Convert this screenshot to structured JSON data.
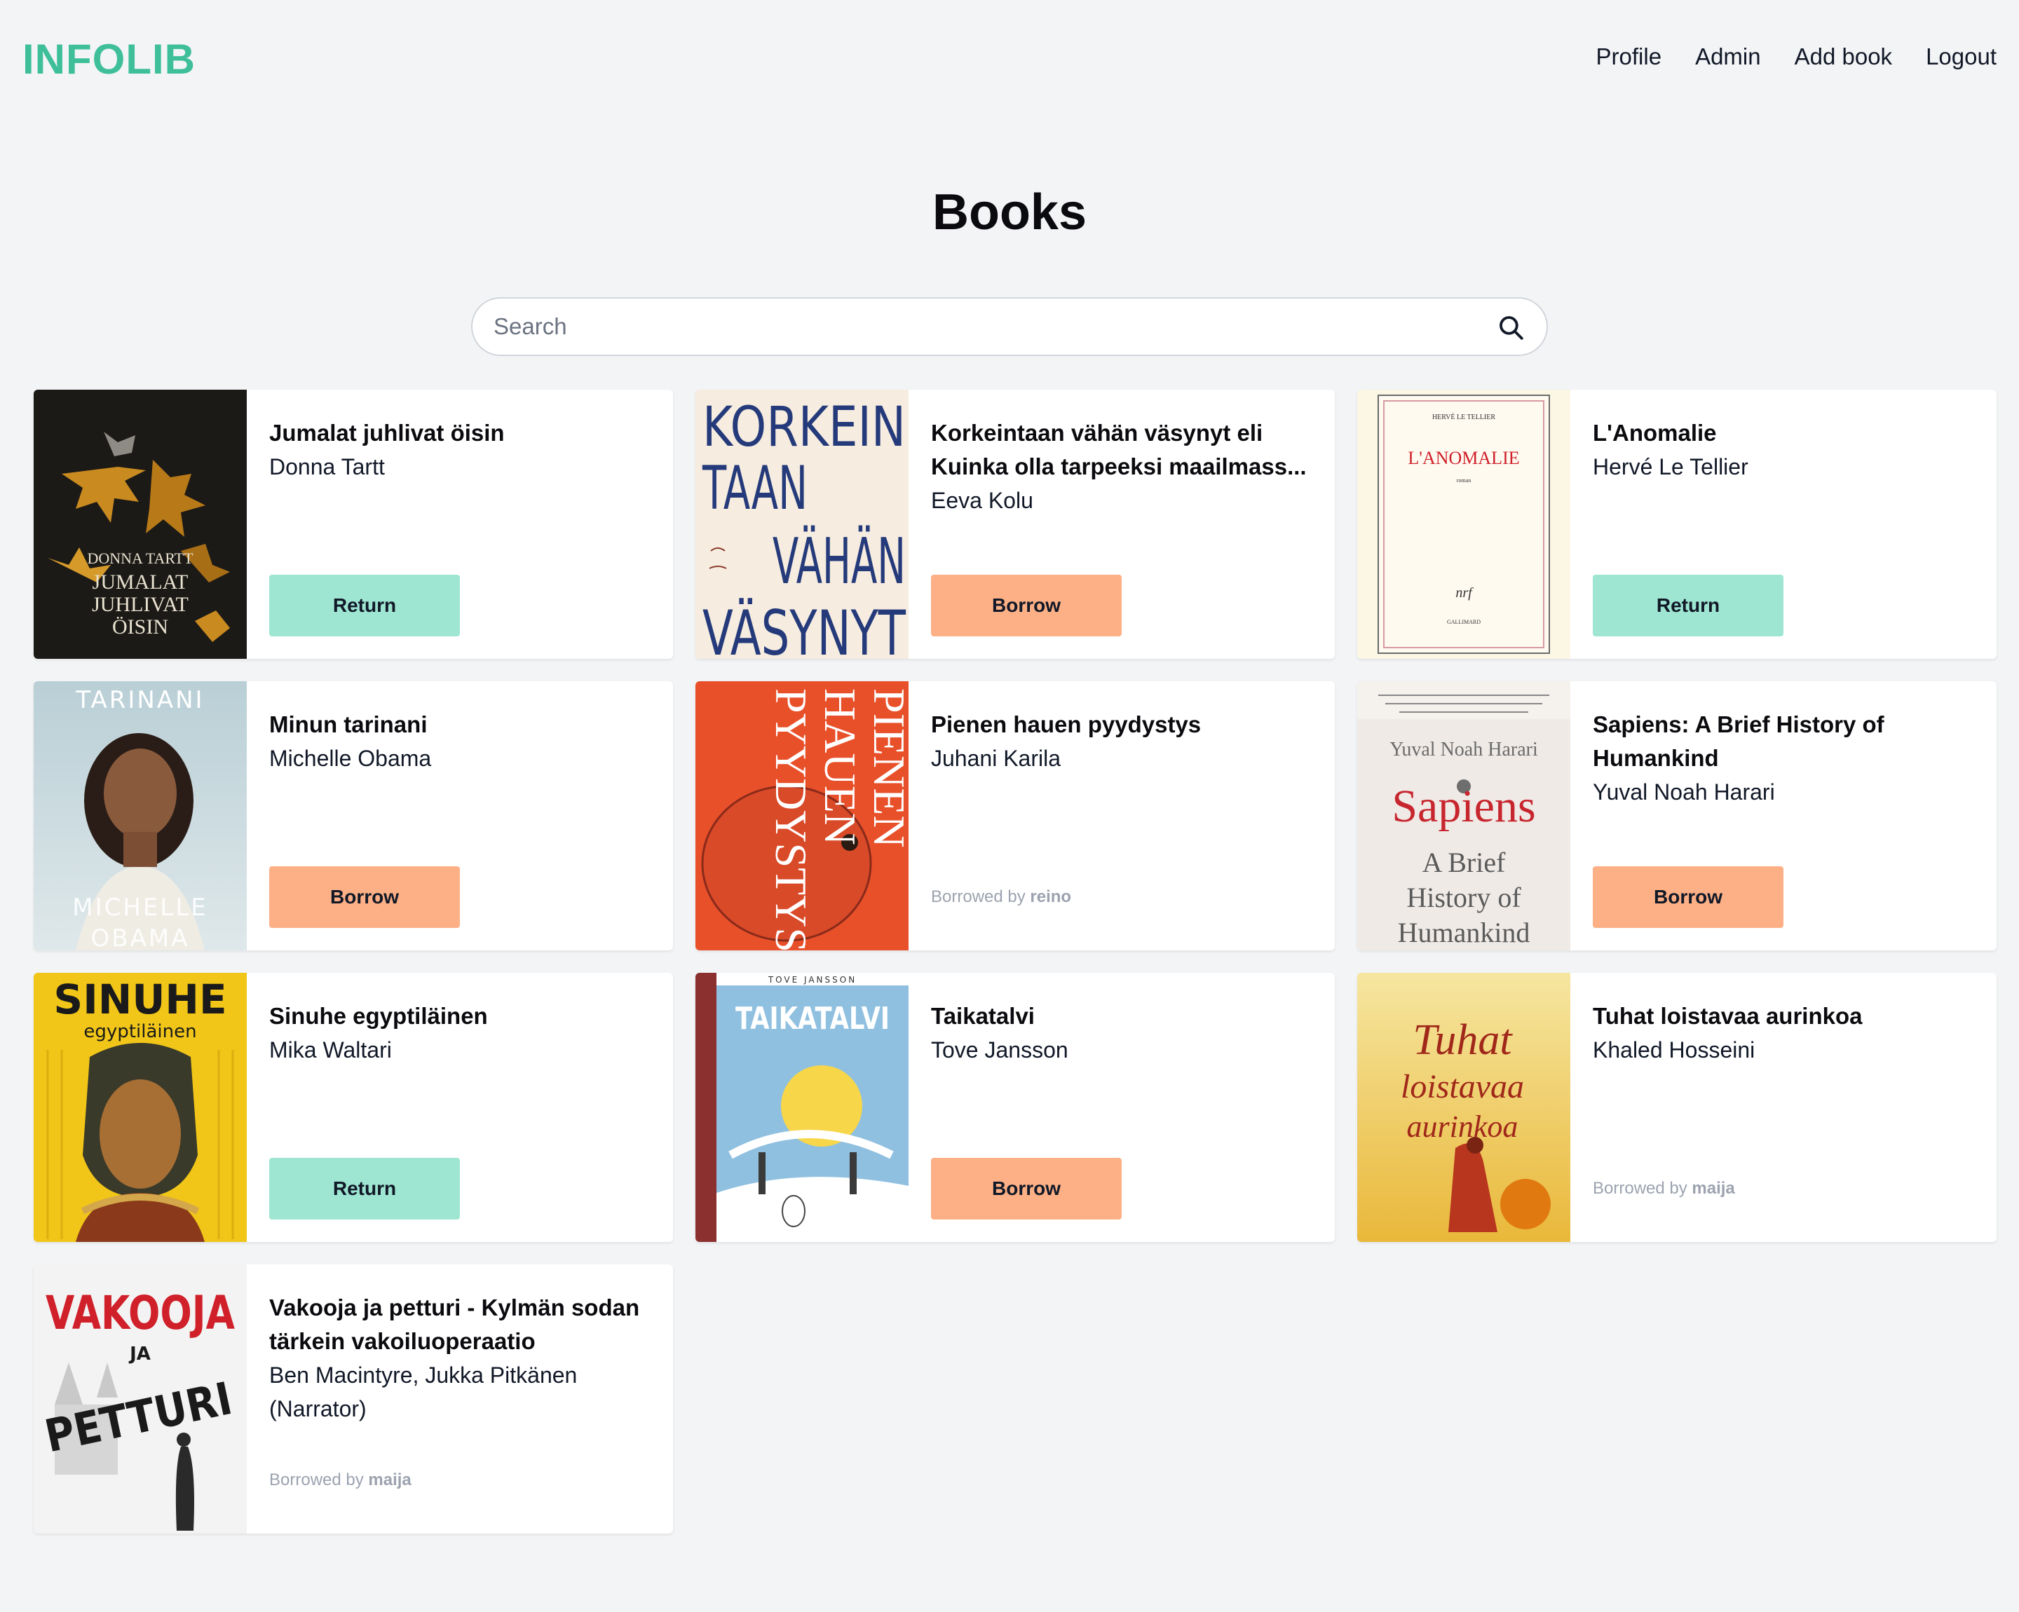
{
  "nav": {
    "logo": "INFOLIB",
    "links": [
      "Profile",
      "Admin",
      "Add book",
      "Logout"
    ]
  },
  "page": {
    "title": "Books"
  },
  "search": {
    "placeholder": "Search",
    "value": ""
  },
  "borrowed_prefix": "Borrowed by",
  "books": [
    {
      "title": "Jumalat juhlivat öisin",
      "author": "Donna Tartt",
      "action": "Return",
      "borrowed_by": "",
      "cover_text": [
        "DONNA TARTT",
        "JUMALAT",
        "JUHLIVAT",
        "ÖISIN"
      ]
    },
    {
      "title": "Korkeintaan vähän väsynyt eli Kuinka olla tarpeeksi maailmass...",
      "author": "Eeva Kolu",
      "action": "Borrow",
      "borrowed_by": "",
      "cover_text": [
        "KORKEIN",
        "TAAN",
        "VÄHÄN",
        "VÄSYNYT"
      ]
    },
    {
      "title": "L'Anomalie",
      "author": "Hervé Le Tellier",
      "action": "Return",
      "borrowed_by": "",
      "cover_text": [
        "HERVÉ LE TELLIER",
        "L'ANOMALIE",
        "roman",
        "nrf",
        "GALLIMARD"
      ]
    },
    {
      "title": "Minun tarinani",
      "author": "Michelle Obama",
      "action": "Borrow",
      "borrowed_by": "",
      "cover_text": [
        "TARINANI",
        "MICHELLE",
        "OBAMA"
      ]
    },
    {
      "title": "Pienen hauen pyydystys",
      "author": "Juhani Karila",
      "action": "",
      "borrowed_by": "reino",
      "cover_text": [
        "PIENEN",
        "HAUEN",
        "PYYDYSTYS"
      ]
    },
    {
      "title": "Sapiens: A Brief History of Humankind",
      "author": "Yuval Noah Harari",
      "action": "Borrow",
      "borrowed_by": "",
      "cover_text": [
        "Yuval Noah Harari",
        "Sapiens",
        "A Brief",
        "History of",
        "Humankind"
      ]
    },
    {
      "title": "Sinuhe egyptiläinen",
      "author": "Mika Waltari",
      "action": "Return",
      "borrowed_by": "",
      "cover_text": [
        "SINUHE",
        "egyptiläinen"
      ]
    },
    {
      "title": "Taikatalvi",
      "author": "Tove Jansson",
      "action": "Borrow",
      "borrowed_by": "",
      "cover_text": [
        "TOVE JANSSON",
        "TAIKATALVI"
      ]
    },
    {
      "title": "Tuhat loistavaa aurinkoa",
      "author": "Khaled Hosseini",
      "action": "",
      "borrowed_by": "maija",
      "cover_text": [
        "Tuhat",
        "loistavaa",
        "aurinkoa"
      ]
    },
    {
      "title": "Vakooja ja petturi - Kylmän sodan tärkein vakoiluoperaatio",
      "author": "Ben Macintyre, Jukka Pitkänen (Narrator)",
      "action": "",
      "borrowed_by": "maija",
      "cover_text": [
        "VAKOOJA",
        "JA",
        "PETTURI"
      ]
    }
  ],
  "colors": {
    "brand": "#3ebf9a",
    "return_button": "#9ee6d2",
    "borrow_button": "#fdb086",
    "background": "#f3f4f6"
  }
}
